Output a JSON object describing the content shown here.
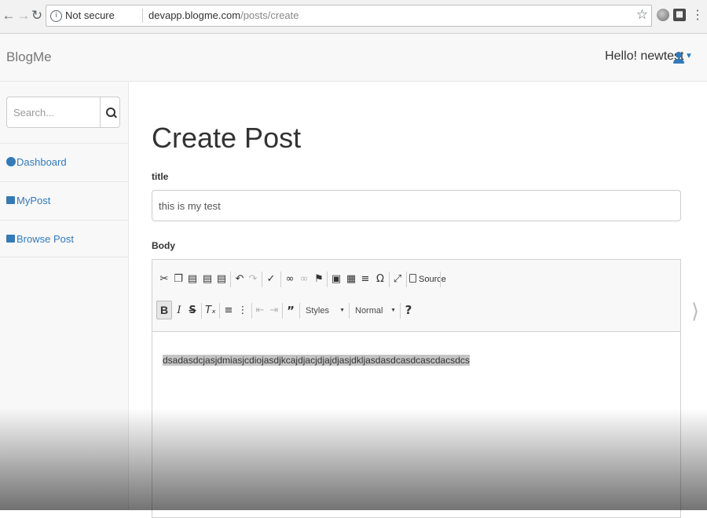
{
  "browser": {
    "security_text": "Not secure",
    "url_host": "devapp.blogme.com",
    "url_path": "/posts/create"
  },
  "navbar": {
    "brand": "BlogMe",
    "greeting": "Hello! newtest"
  },
  "sidebar": {
    "search": {
      "placeholder": "Search..."
    },
    "items": [
      {
        "label": "Dashboard",
        "icon": "dashboard-icon"
      },
      {
        "label": "MyPost",
        "icon": "list-icon"
      },
      {
        "label": "Browse Post",
        "icon": "list-icon"
      }
    ]
  },
  "main": {
    "page_title": "Create Post",
    "title_label": "title",
    "title_value": "this is my test",
    "body_label": "Body"
  },
  "editor": {
    "source_label": "Source",
    "styles_label": "Styles",
    "format_label": "Normal",
    "content": "dsadasdcjasjdmiasjcdiojasdjkcajdjacjdjajdjasjdkljasdasdcasdcascdacsdcs"
  },
  "colors": {
    "link": "#337ab7",
    "navbar_bg": "#f8f8f8",
    "selection": "#c4c4c4"
  }
}
